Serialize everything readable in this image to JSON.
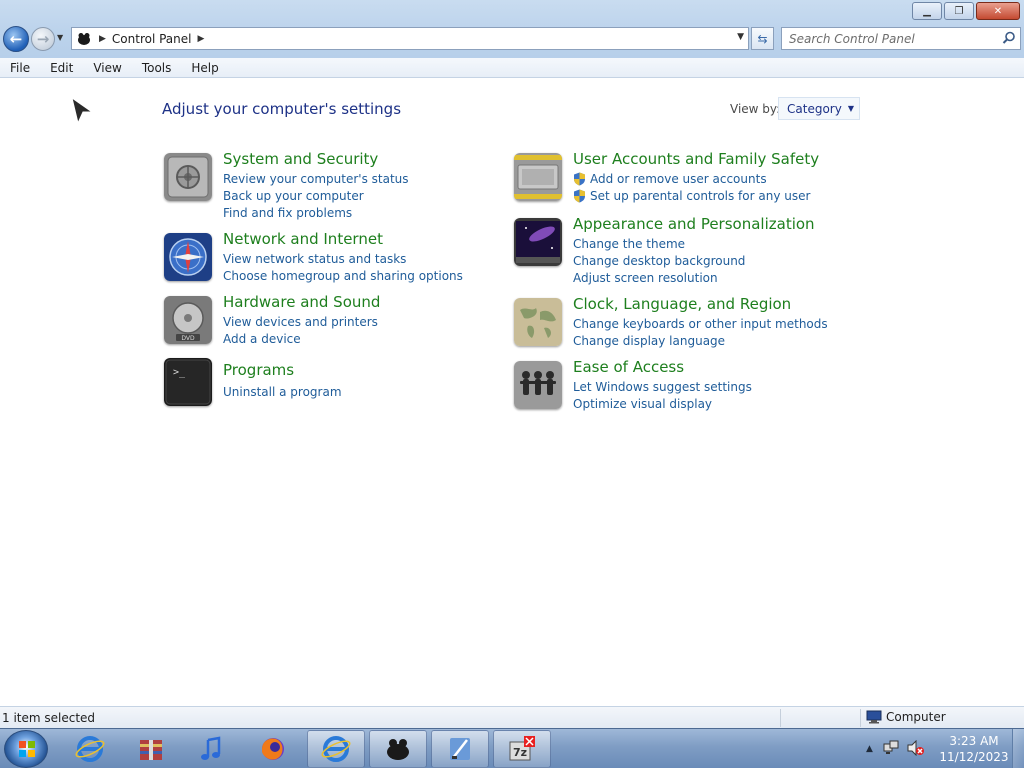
{
  "window": {
    "caption_buttons": {
      "minimize": "minimize-icon",
      "restore": "restore-icon",
      "close": "close-icon"
    }
  },
  "navigation": {
    "back_icon": "back-arrow-icon",
    "forward_icon": "forward-arrow-icon",
    "address": {
      "crumbs": [
        "Control Panel"
      ]
    },
    "search": {
      "placeholder": "Search Control Panel"
    }
  },
  "menu": [
    "File",
    "Edit",
    "View",
    "Tools",
    "Help"
  ],
  "main": {
    "title": "Adjust your computer's settings",
    "view_by_label": "View by:",
    "view_by_value": "Category",
    "categories": [
      {
        "title": "System and Security",
        "icon": "vault-icon",
        "links": [
          "Review your computer's status",
          "Back up your computer",
          "Find and fix problems"
        ]
      },
      {
        "title": "Network and Internet",
        "icon": "compass-network-icon",
        "links": [
          "View network status and tasks",
          "Choose homegroup and sharing options"
        ]
      },
      {
        "title": "Hardware and Sound",
        "icon": "dvd-drive-icon",
        "links": [
          "View devices and printers",
          "Add a device"
        ]
      },
      {
        "title": "Programs",
        "icon": "terminal-icon",
        "links": [
          "Uninstall a program"
        ]
      },
      {
        "title": "User Accounts and Family Safety",
        "icon": "authorized-access-icon",
        "links": [
          "Add or remove user accounts",
          "Set up parental controls for any user"
        ]
      },
      {
        "title": "Appearance and Personalization",
        "icon": "galaxy-wallpaper-icon",
        "links": [
          "Change the theme",
          "Change desktop background",
          "Adjust screen resolution"
        ]
      },
      {
        "title": "Clock, Language, and Region",
        "icon": "world-map-icon",
        "links": [
          "Change keyboards or other input methods",
          "Change display language"
        ]
      },
      {
        "title": "Ease of Access",
        "icon": "people-icon",
        "links": [
          "Let Windows suggest settings",
          "Optimize visual display"
        ]
      }
    ]
  },
  "statusbar": {
    "selection": "1 item selected",
    "zone": "Computer"
  },
  "taskbar": {
    "clock_time": "3:23 AM",
    "clock_date": "11/12/2023",
    "pinned": [
      "internet-explorer-icon",
      "archive-app-icon",
      "music-player-icon",
      "firefox-icon",
      "internet-explorer-icon",
      "paint-app-icon",
      "developer-tool-icon",
      "7zip-icon"
    ]
  },
  "colors": {
    "category_title": "#1e7f1e",
    "link": "#1f5c99",
    "heading": "#1e3287"
  }
}
